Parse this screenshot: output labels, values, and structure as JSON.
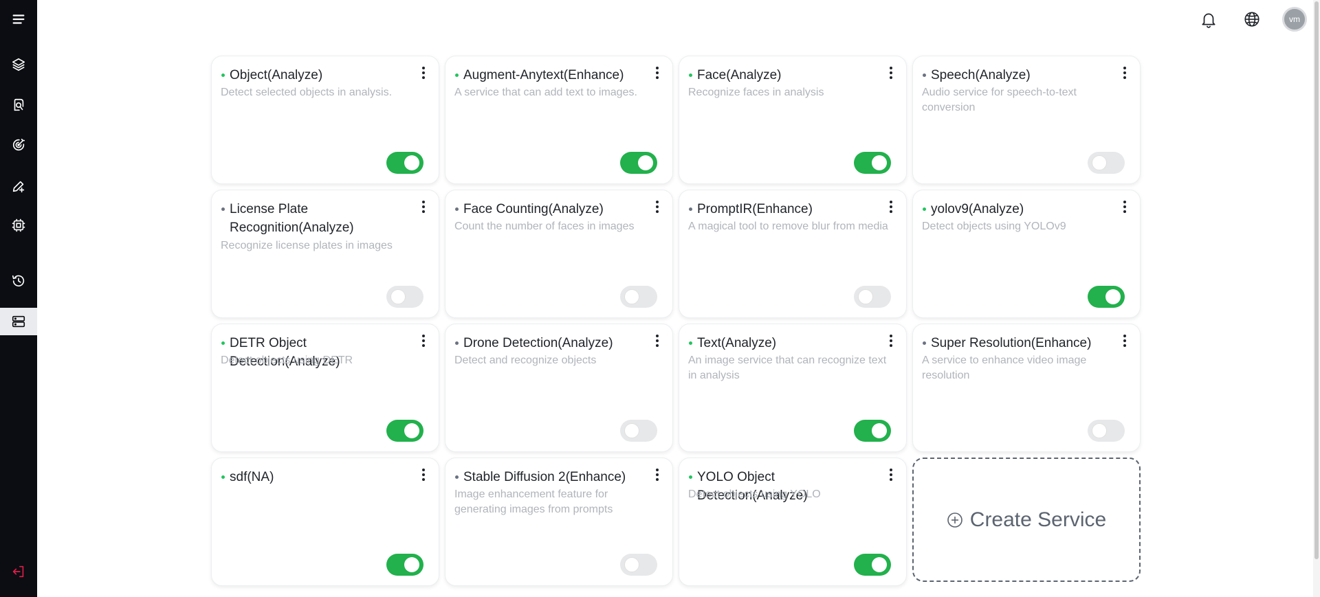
{
  "sidebar": {
    "items": [
      {
        "name": "menu-icon"
      },
      {
        "name": "layers-icon"
      },
      {
        "name": "search-document-icon"
      },
      {
        "name": "target-icon"
      },
      {
        "name": "edit-add-icon"
      },
      {
        "name": "chip-icon"
      },
      {
        "name": "history-icon"
      },
      {
        "name": "servers-icon",
        "active": true
      },
      {
        "name": "logout-icon"
      }
    ]
  },
  "header": {
    "avatar_initials": "vm"
  },
  "services": [
    {
      "title": "Object(Analyze)",
      "description": "Detect selected objects in analysis.",
      "enabled": true
    },
    {
      "title": "Augment-Anytext(Enhance)",
      "description": "A service that can add text to images.",
      "enabled": true
    },
    {
      "title": "Face(Analyze)",
      "description": "Recognize faces in analysis",
      "enabled": true
    },
    {
      "title": "Speech(Analyze)",
      "description": "Audio service for speech-to-text conversion",
      "enabled": false
    },
    {
      "title": "License Plate Recognition(Analyze)",
      "description": "Recognize license plates in images",
      "enabled": false
    },
    {
      "title": "Face Counting(Analyze)",
      "description": "Count the number of faces in images",
      "enabled": false
    },
    {
      "title": "PromptIR(Enhance)",
      "description": "A magical tool to remove blur from media",
      "enabled": false
    },
    {
      "title": "yolov9(Analyze)",
      "description": "Detect objects using YOLOv9",
      "enabled": true
    },
    {
      "title": "DETR Object Detection(Analyze)",
      "description": "Detect objects using DETR",
      "enabled": true
    },
    {
      "title": "Drone Detection(Analyze)",
      "description": "Detect and recognize objects",
      "enabled": false
    },
    {
      "title": "Text(Analyze)",
      "description": "An image service that can recognize text in analysis",
      "enabled": true
    },
    {
      "title": "Super Resolution(Enhance)",
      "description": "A service to enhance video image resolution",
      "enabled": false
    },
    {
      "title": "sdf(NA)",
      "description": "",
      "enabled": true
    },
    {
      "title": "Stable Diffusion 2(Enhance)",
      "description": "Image enhancement feature for generating images from prompts",
      "enabled": false
    },
    {
      "title": "YOLO Object Detection(Analyze)",
      "description": "Detect objects using YOLO",
      "enabled": true
    }
  ],
  "create_service": {
    "label": "Create Service"
  },
  "colors": {
    "sidebar_bg": "#0b0d12",
    "toggle_on": "#22b14c",
    "status_on": "#22c55e",
    "status_off": "#6b7280",
    "logout_accent": "#e11d48"
  }
}
